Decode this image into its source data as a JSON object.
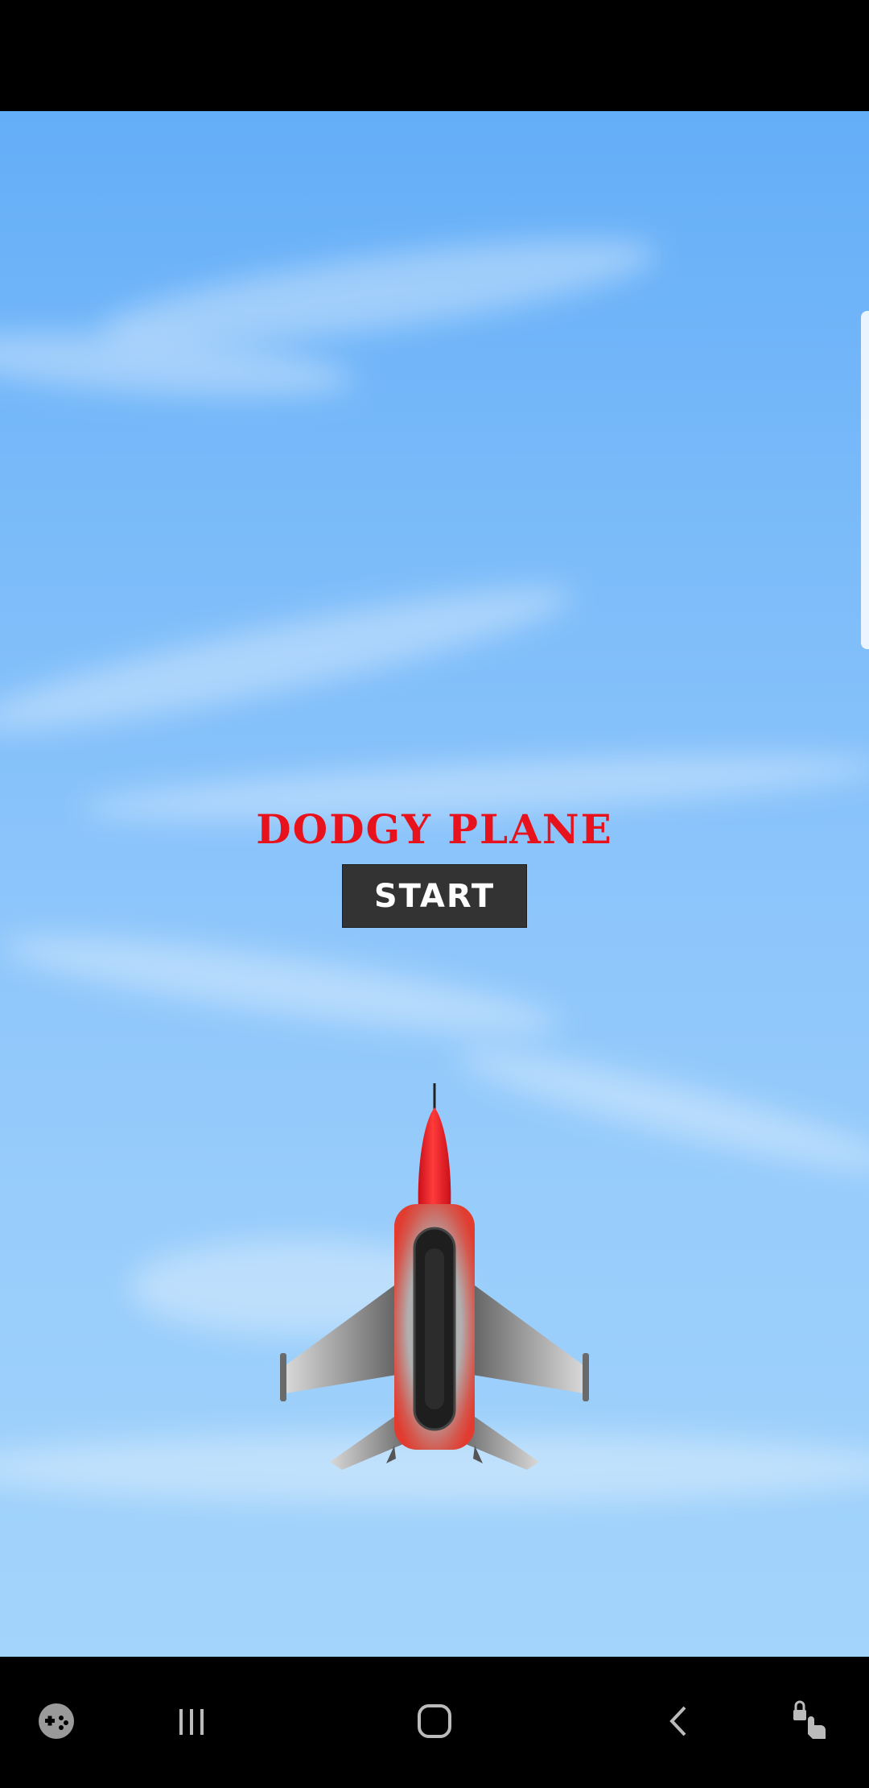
{
  "game": {
    "title": "DODGY PLANE",
    "start_label": "START"
  },
  "colors": {
    "sky_top": "#64aef8",
    "sky_bottom": "#a3d4fb",
    "title": "#e8121c",
    "button_bg": "#333333",
    "button_text": "#ffffff"
  },
  "icons": {
    "player": "fighter-jet-icon",
    "nav": [
      "game-launcher-icon",
      "recent-apps-icon",
      "home-icon",
      "back-icon",
      "touch-lock-icon"
    ]
  }
}
